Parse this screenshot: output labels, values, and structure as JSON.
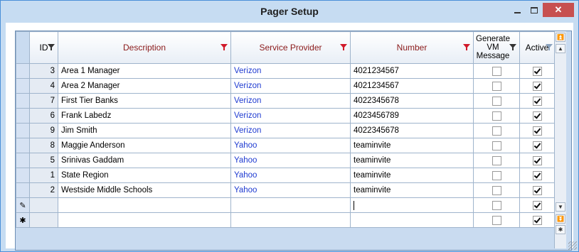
{
  "window": {
    "title": "Pager Setup",
    "controls": [
      "minimize",
      "maximize",
      "close"
    ]
  },
  "grid": {
    "columns": {
      "id": "ID",
      "description": "Description",
      "provider": "Service Provider",
      "number": "Number",
      "generate": "Generate VM Message",
      "active": "Active"
    },
    "rows": [
      {
        "id": "3",
        "description": "Area 1 Manager",
        "provider": "Verizon",
        "number": "4021234567",
        "generate": false,
        "active": true
      },
      {
        "id": "4",
        "description": "Area 2 Manager",
        "provider": "Verizon",
        "number": "4021234567",
        "generate": false,
        "active": true
      },
      {
        "id": "7",
        "description": "First Tier Banks",
        "provider": "Verizon",
        "number": "4022345678",
        "generate": false,
        "active": true
      },
      {
        "id": "6",
        "description": "Frank Labedz",
        "provider": "Verizon",
        "number": "4023456789",
        "generate": false,
        "active": true
      },
      {
        "id": "9",
        "description": "Jim Smith",
        "provider": "Verizon",
        "number": "4022345678",
        "generate": false,
        "active": true
      },
      {
        "id": "8",
        "description": "Maggie Anderson",
        "provider": "Yahoo",
        "number": "teaminvite",
        "generate": false,
        "active": true
      },
      {
        "id": "5",
        "description": "Srinivas Gaddam",
        "provider": "Yahoo",
        "number": "teaminvite",
        "generate": false,
        "active": true
      },
      {
        "id": "1",
        "description": "State Region",
        "provider": "Yahoo",
        "number": "teaminvite",
        "generate": false,
        "active": true
      },
      {
        "id": "2",
        "description": "Westside Middle Schools",
        "provider": "Yahoo",
        "number": "teaminvite",
        "generate": false,
        "active": true
      }
    ],
    "new_row_marker": "✱",
    "editing_marker": "✎"
  }
}
